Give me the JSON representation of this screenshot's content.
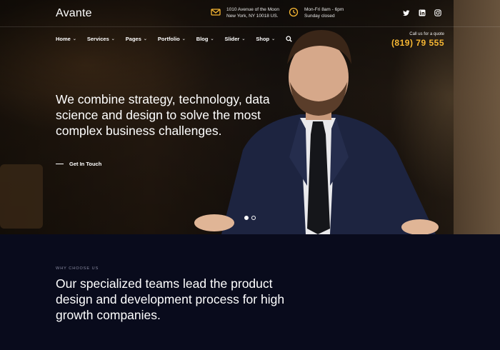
{
  "brand": {
    "logo": "Avante"
  },
  "contact": {
    "address": {
      "icon": "mail-icon",
      "line1": "1010 Avenue of the Moon",
      "line2": "New York, NY 10018 US."
    },
    "hours": {
      "icon": "clock-icon",
      "line1": "Mon-Fri 8am - 6pm",
      "line2": "Sunday closed"
    }
  },
  "social": [
    "twitter-icon",
    "linkedin-icon",
    "instagram-icon"
  ],
  "nav": {
    "items": [
      {
        "label": "Home"
      },
      {
        "label": "Services"
      },
      {
        "label": "Pages"
      },
      {
        "label": "Portfolio"
      },
      {
        "label": "Blog"
      },
      {
        "label": "Slider"
      },
      {
        "label": "Shop"
      }
    ]
  },
  "quote": {
    "label": "Call us for a quote",
    "phone": "(819) 79 555"
  },
  "hero": {
    "headline": "We combine strategy, technology, data science and design to solve the most complex business challenges.",
    "cta": "Get In Touch",
    "slides": 2,
    "active_slide": 1
  },
  "section": {
    "eyebrow": "WHY CHOOSE US",
    "heading": "Our specialized teams lead the product design and development process for high growth companies."
  },
  "colors": {
    "accent": "#f7b733",
    "dark_bg": "#090b1c"
  }
}
